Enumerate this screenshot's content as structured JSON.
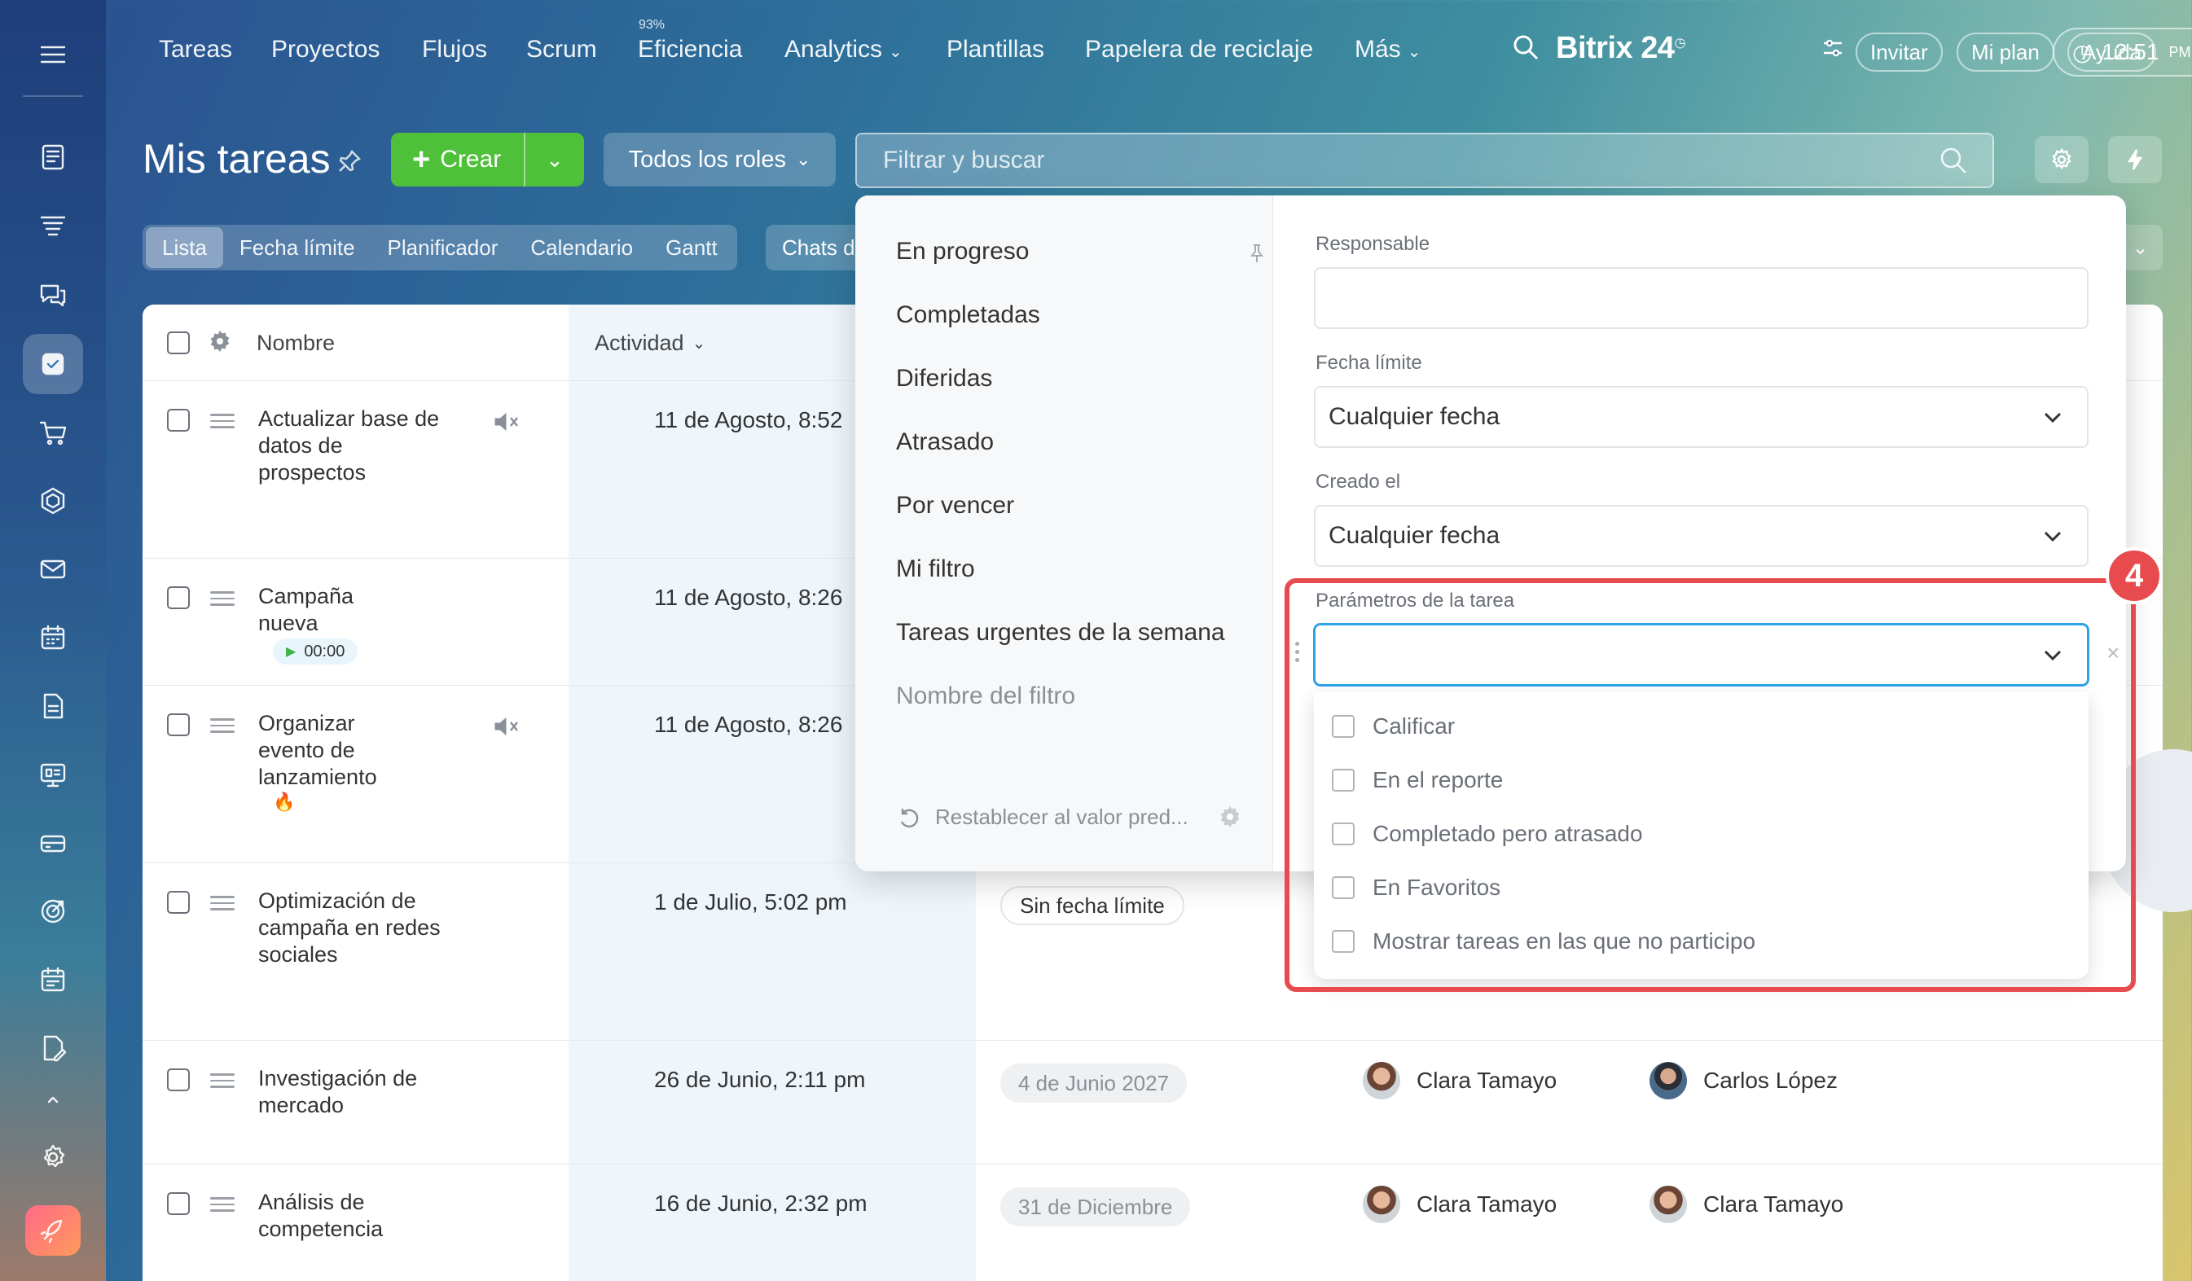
{
  "nav": {
    "items": [
      "Tareas",
      "Proyectos",
      "Flujos",
      "Scrum",
      "Eficiencia",
      "Analytics",
      "Plantillas",
      "Papelera de reciclaje",
      "Más"
    ],
    "efficiency_pct": "93%",
    "brand": "Bitrix 24",
    "invite": "Invitar",
    "plan": "Mi plan",
    "help": "Ayuda",
    "clock_time": "12:51",
    "clock_ampm": "PM"
  },
  "header": {
    "title": "Mis tareas",
    "create_label": "Crear",
    "roles_label": "Todos los roles",
    "search_placeholder": "Filtrar y buscar"
  },
  "tabs": [
    "Lista",
    "Fecha límite",
    "Planificador",
    "Calendario",
    "Gantt"
  ],
  "chats_tab": "Chats d",
  "table": {
    "col_name": "Nombre",
    "col_activity": "Actividad",
    "rows": [
      {
        "name": "Actualizar base de datos de prospectos",
        "activity": "11 de Agosto, 8:52"
      },
      {
        "name": "Campaña nueva",
        "activity": "11 de Agosto, 8:26",
        "timer": "00:00"
      },
      {
        "name": "Organizar evento de lanzamiento",
        "activity": "11 de Agosto, 8:26"
      },
      {
        "name": "Optimización de campaña en redes sociales",
        "activity": "1 de Julio, 5:02 pm",
        "deadline": "Sin fecha límite"
      },
      {
        "name": "Investigación de mercado",
        "activity": "26 de Junio, 2:11 pm",
        "deadline": "4 de Junio 2027",
        "responsible": "Clara Tamayo",
        "creator": "Carlos López"
      },
      {
        "name": "Análisis de competencia",
        "activity": "16 de Junio, 2:32 pm",
        "deadline": "31 de Diciembre",
        "responsible": "Clara Tamayo",
        "creator": "Clara Tamayo"
      }
    ]
  },
  "filter_popup": {
    "presets": [
      "En progreso",
      "Completadas",
      "Diferidas",
      "Atrasado",
      "Por vencer",
      "Mi filtro",
      "Tareas urgentes de la semana"
    ],
    "filter_name_placeholder": "Nombre del filtro",
    "reset_label": "Restablecer al valor pred...",
    "fields": {
      "responsible_label": "Responsable",
      "deadline_label": "Fecha límite",
      "deadline_value": "Cualquier fecha",
      "created_label": "Creado el",
      "created_value": "Cualquier fecha",
      "params_label": "Parámetros de la tarea"
    },
    "params_options": [
      "Calificar",
      "En el reporte",
      "Completado pero atrasado",
      "En Favoritos",
      "Mostrar tareas en las que no participo"
    ]
  },
  "annotation": {
    "step": "4",
    "color": "#e84b4e"
  },
  "colors": {
    "create_green": "#4ec03a",
    "focus_blue": "#2fa3e6"
  }
}
